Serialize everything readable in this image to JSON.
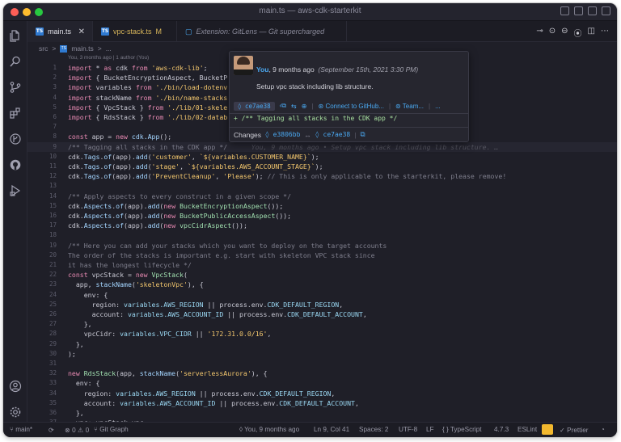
{
  "window": {
    "title": "main.ts — aws-cdk-starterkit"
  },
  "tabs": [
    {
      "label": "main.ts",
      "active": true,
      "close": "✕"
    },
    {
      "label": "vpc-stack.ts",
      "modified": "M"
    },
    {
      "label": "Extension: GitLens — Git supercharged"
    }
  ],
  "breadcrumb": {
    "segments": [
      "src",
      ">",
      "main.ts",
      ">",
      "..."
    ],
    "codelens": "You, 3 months ago | 1 author (You)"
  },
  "editor": {
    "lines": [
      {
        "n": "1",
        "html": "<span class='kw'>import</span> * <span class='kw'>as</span> cdk <span class='kw'>from</span> <span class='str'>'aws-cdk-lib'</span>;"
      },
      {
        "n": "2",
        "html": "<span class='kw'>import</span> { BucketEncryptionAspect, BucketP"
      },
      {
        "n": "3",
        "html": "<span class='kw'>import</span> variables <span class='kw'>from</span> <span class='str'>'./bin/load-dotenv</span>"
      },
      {
        "n": "4",
        "html": "<span class='kw'>import</span> stackName <span class='kw'>from</span> <span class='str'>'./bin/name-stacks</span>"
      },
      {
        "n": "5",
        "html": "<span class='kw'>import</span> { VpcStack } <span class='kw'>from</span> <span class='str'>'./lib/01-skele</span>"
      },
      {
        "n": "6",
        "html": "<span class='kw'>import</span> { RdsStack } <span class='kw'>from</span> <span class='str'>'./lib/02-datab</span>"
      },
      {
        "n": "7",
        "html": ""
      },
      {
        "n": "8",
        "html": "<span class='kw'>const</span> app = <span class='kw'>new</span> <span class='fn'>cdk.App</span>();"
      },
      {
        "n": "9",
        "html": "<span class='cm'>/** Tagging all stacks in the CDK app */</span>      <span class='ghost-blame'>You, 9 months ago • Setup vpc stack including lib structure. …</span>",
        "current": true
      },
      {
        "n": "10",
        "html": "cdk.<span class='fn'>Tags</span>.<span class='fn'>of</span>(app).<span class='fn'>add</span>(<span class='str'>'customer'</span>, <span class='str'>`${variables.CUSTOMER_NAME}`</span>);"
      },
      {
        "n": "11",
        "html": "cdk.<span class='fn'>Tags</span>.<span class='fn'>of</span>(app).<span class='fn'>add</span>(<span class='str'>'stage'</span>, <span class='str'>`${variables.AWS_ACCOUNT_STAGE}`</span>);"
      },
      {
        "n": "12",
        "html": "cdk.<span class='fn'>Tags</span>.<span class='fn'>of</span>(app).<span class='fn'>add</span>(<span class='str'>'PreventCleanup'</span>, <span class='str'>'Please'</span>); <span class='cm'>// This is only applicable to the starterkit, please remove!</span>"
      },
      {
        "n": "13",
        "html": ""
      },
      {
        "n": "14",
        "html": "<span class='cm'>/** Apply aspects to every construct in a given scope */</span>"
      },
      {
        "n": "15",
        "html": "cdk.<span class='fn'>Aspects</span>.<span class='fn'>of</span>(app).<span class='fn'>add</span>(<span class='kw'>new</span> <span class='cls'>BucketEncryptionAspect</span>());"
      },
      {
        "n": "16",
        "html": "cdk.<span class='fn'>Aspects</span>.<span class='fn'>of</span>(app).<span class='fn'>add</span>(<span class='kw'>new</span> <span class='cls'>BucketPublicAccessAspect</span>());"
      },
      {
        "n": "17",
        "html": "cdk.<span class='fn'>Aspects</span>.<span class='fn'>of</span>(app).<span class='fn'>add</span>(<span class='kw'>new</span> <span class='cls'>vpcCidrAspect</span>());"
      },
      {
        "n": "18",
        "html": ""
      },
      {
        "n": "19",
        "html": "<span class='cm'>/** Here you can add your stacks which you want to deploy on the target accounts</span>"
      },
      {
        "n": "20",
        "html": "<span class='cm'>The order of the stacks is important e.g. start with skeleton VPC stack since</span>"
      },
      {
        "n": "21",
        "html": "<span class='cm'>it has the longest lifecycle */</span>"
      },
      {
        "n": "22",
        "html": "<span class='kw'>const</span> vpcStack = <span class='kw'>new</span> <span class='cls'>VpcStack</span>("
      },
      {
        "n": "23",
        "html": "  app, <span class='fn'>stackName</span>(<span class='str'>'skeletonVpc'</span>), {"
      },
      {
        "n": "24",
        "html": "    env: {"
      },
      {
        "n": "25",
        "html": "      region: <span class='var'>variables.AWS_REGION</span> || process.env.<span class='var'>CDK_DEFAULT_REGION</span>,"
      },
      {
        "n": "26",
        "html": "      account: <span class='var'>variables.AWS_ACCOUNT_ID</span> || process.env.<span class='var'>CDK_DEFAULT_ACCOUNT</span>,"
      },
      {
        "n": "27",
        "html": "    },"
      },
      {
        "n": "28",
        "html": "    vpcCidr: <span class='var'>variables.VPC_CIDR</span> || <span class='str'>'172.31.0.0/16'</span>,"
      },
      {
        "n": "29",
        "html": "  },"
      },
      {
        "n": "30",
        "html": ");"
      },
      {
        "n": "31",
        "html": ""
      },
      {
        "n": "32",
        "html": "<span class='kw'>new</span> <span class='cls'>RdsStack</span>(app, <span class='fn'>stackName</span>(<span class='str'>'serverlessAurora'</span>), {"
      },
      {
        "n": "33",
        "html": "  env: {"
      },
      {
        "n": "34",
        "html": "    region: <span class='var'>variables.AWS_REGION</span> || process.env.<span class='var'>CDK_DEFAULT_REGION</span>,"
      },
      {
        "n": "35",
        "html": "    account: <span class='var'>variables.AWS_ACCOUNT_ID</span> || process.env.<span class='var'>CDK_DEFAULT_ACCOUNT</span>,"
      },
      {
        "n": "36",
        "html": "  },"
      },
      {
        "n": "37",
        "html": "  vpc: vpcStack.vpc,"
      }
    ]
  },
  "hover": {
    "author": "You",
    "when": ", 9 months ago",
    "date": "(September 15th, 2021 3:30 PM)",
    "message": "Setup vpc stack including lib structure.",
    "sha": "◊ ce7ae38",
    "connect": "Connect to GitHub...",
    "team": "Team...",
    "more": "...",
    "diff": "+ /** Tagging all stacks in the CDK app */",
    "changes_label": "Changes",
    "from_sha": "◊ e3806bb",
    "arrow": "↔",
    "to_sha": "◊ ce7ae38"
  },
  "statusbar": {
    "branch": "main*",
    "sync": "⟳",
    "problems": "⊗ 0 ⚠ 0",
    "git_graph": "Git Graph",
    "blame": "◊ You, 9 months ago",
    "position": "Ln 9, Col 41",
    "spaces": "Spaces: 2",
    "encoding": "UTF-8",
    "eol": "LF",
    "language": "{ } TypeScript",
    "ts_version": "4.7.3",
    "eslint": "ESLint",
    "prettier": "✓ Prettier",
    "bell": "🔔"
  },
  "icons": {
    "activity": [
      "files-icon",
      "search-icon",
      "source-control-icon",
      "extensions-icon",
      "gitlens-icon",
      "github-icon",
      "run-icon",
      "account-icon",
      "settings-gear-icon"
    ]
  },
  "colors": {
    "background": "#1f1f28",
    "accent": "#4aa8f0",
    "eslint_badge": "#f2b82e"
  }
}
